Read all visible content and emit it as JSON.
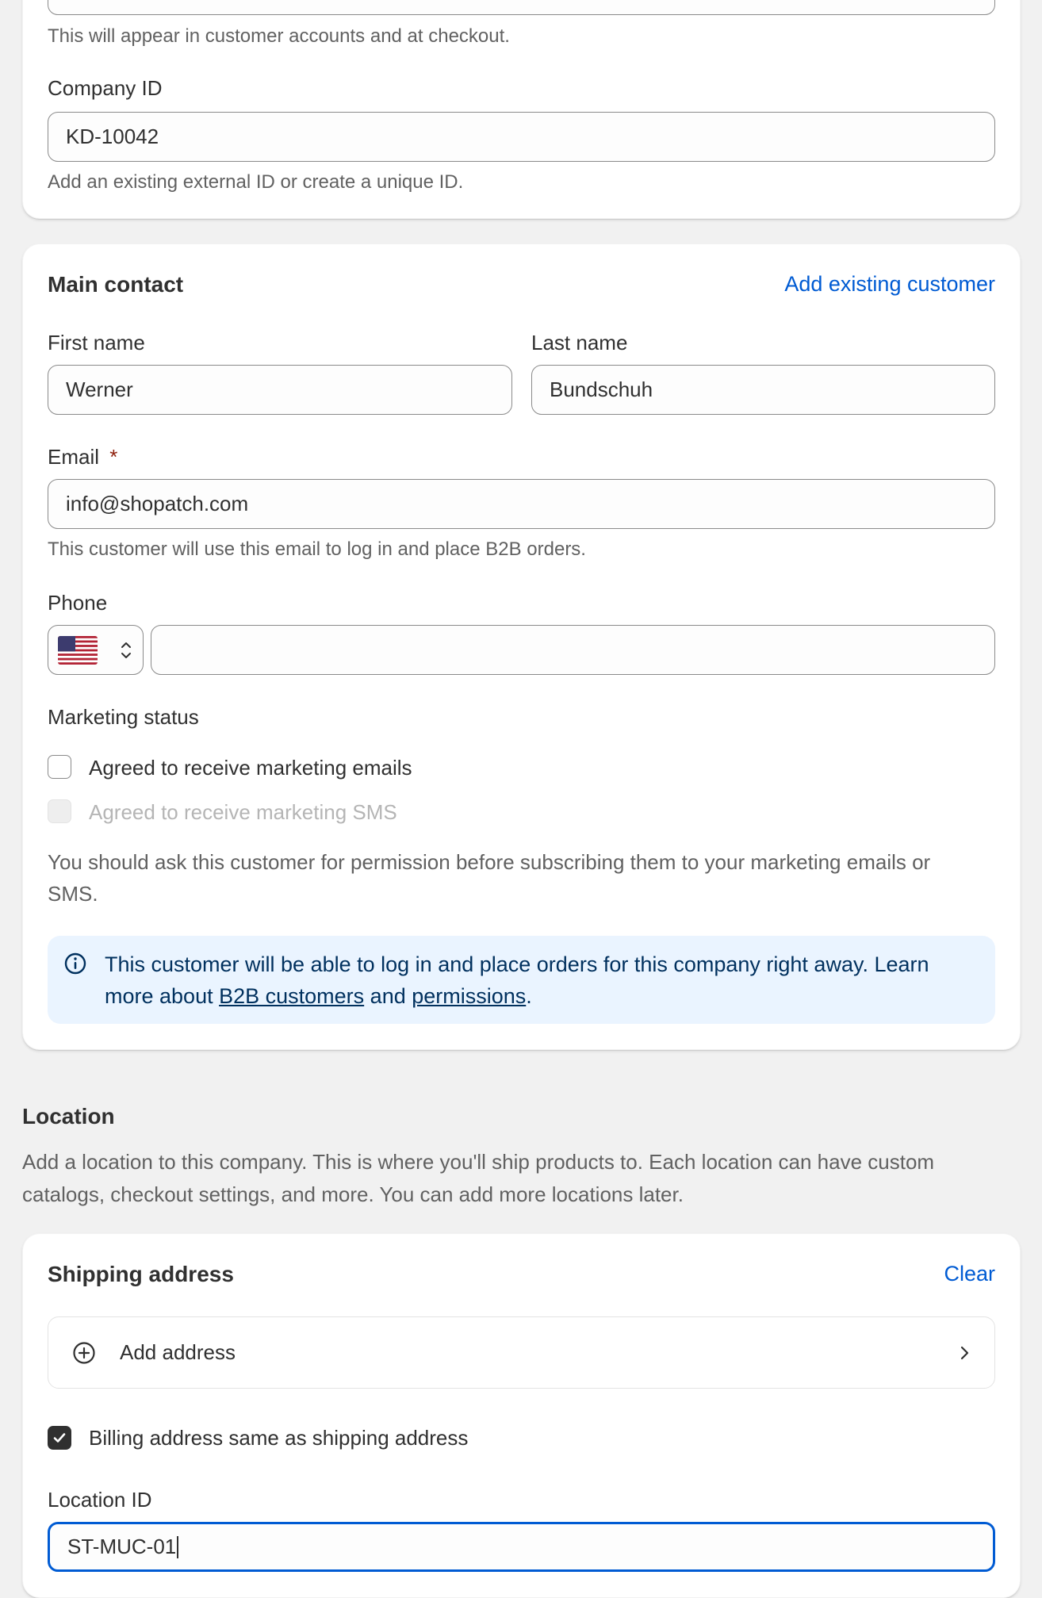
{
  "company_card": {
    "name_help": "This will appear in customer accounts and at checkout.",
    "company_id_label": "Company ID",
    "company_id_value": "KD-10042",
    "company_id_help": "Add an existing external ID or create a unique ID."
  },
  "main_contact": {
    "title": "Main contact",
    "add_existing_label": "Add existing customer",
    "first_name_label": "First name",
    "first_name_value": "Werner",
    "last_name_label": "Last name",
    "last_name_value": "Bundschuh",
    "email_label": "Email",
    "email_required_mark": "*",
    "email_value": "info@shopatch.com",
    "email_help": "This customer will use this email to log in and place B2B orders.",
    "phone_label": "Phone",
    "phone_value": "",
    "marketing_status_label": "Marketing status",
    "marketing_email_label": "Agreed to receive marketing emails",
    "marketing_sms_label": "Agreed to receive marketing SMS",
    "permission_note": "You should ask this customer for permission before subscribing them to your marketing emails or SMS.",
    "banner": {
      "text_start": "This customer will be able to log in and place orders for this company right away. Learn more about ",
      "link_b2b": "B2B customers",
      "text_mid": " and ",
      "link_permissions": "permissions",
      "text_end": "."
    }
  },
  "location": {
    "title": "Location",
    "description": "Add a location to this company. This is where you'll ship products to. Each location can have custom catalogs, checkout settings, and more. You can add more locations later."
  },
  "shipping_card": {
    "title": "Shipping address",
    "clear_label": "Clear",
    "add_address_label": "Add address",
    "billing_same_label": "Billing address same as shipping address",
    "location_id_label": "Location ID",
    "location_id_value": "ST-MUC-01"
  },
  "colors": {
    "accent": "#005bd3",
    "banner_bg": "#eaf4ff",
    "banner_text": "#00305e",
    "required": "#8e1f0b"
  }
}
